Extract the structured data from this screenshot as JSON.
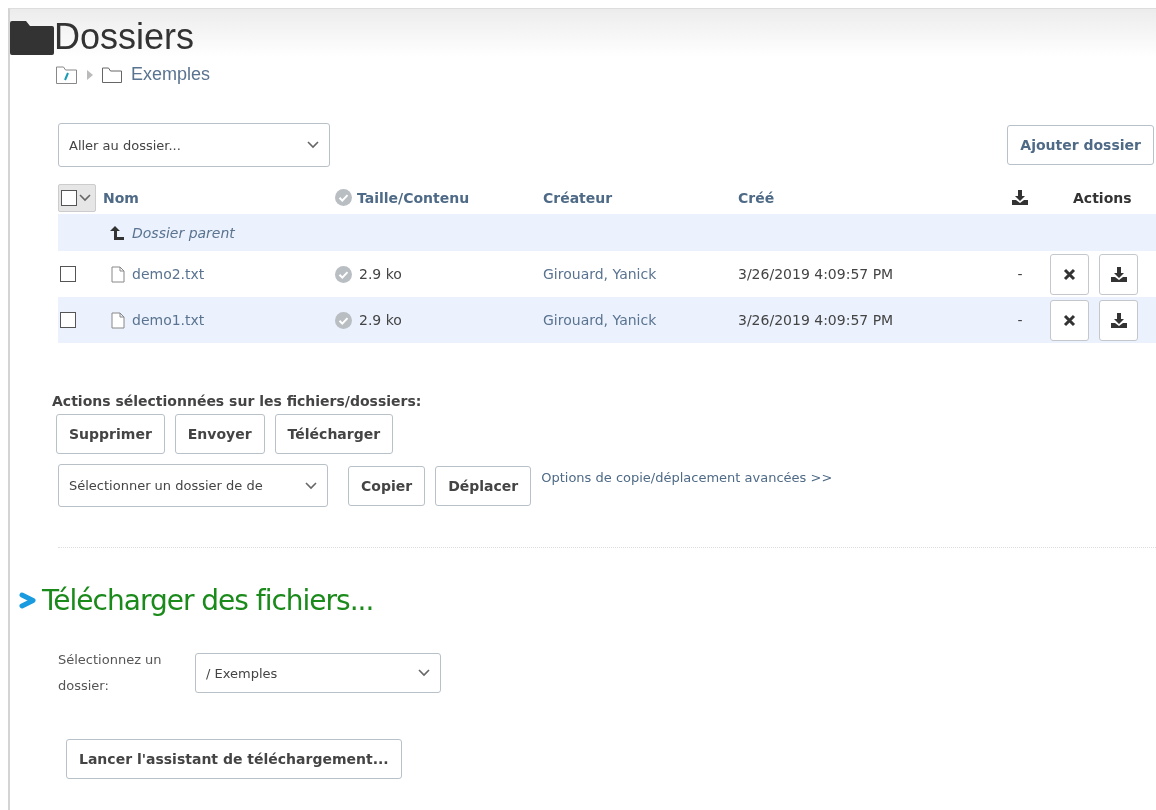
{
  "page": {
    "title": "Dossiers"
  },
  "breadcrumb": [
    {
      "label": "Exemples"
    }
  ],
  "goto_select": {
    "value": "Aller au dossier..."
  },
  "add_folder_button": "Ajouter dossier",
  "table": {
    "select_all": {
      "checked": false
    },
    "columns": [
      {
        "kind": "text",
        "label": "Nom"
      },
      {
        "kind": "status",
        "label": "Taille/Contenu"
      },
      {
        "kind": "text",
        "label": "Créateur"
      },
      {
        "kind": "text",
        "label": "Créé"
      },
      {
        "kind": "download"
      },
      {
        "kind": "plain",
        "label": "Actions"
      }
    ],
    "parent_row": "Dossier parent",
    "rows": [
      {
        "checked": false,
        "name": "demo2.txt",
        "size": "2.9 ko",
        "creator": "Girouard, Yanick",
        "created": "3/26/2019 4:09:57 PM",
        "downloads": "-"
      },
      {
        "checked": false,
        "name": "demo1.txt",
        "size": "2.9 ko",
        "creator": "Girouard, Yanick",
        "created": "3/26/2019 4:09:57 PM",
        "downloads": "-"
      }
    ]
  },
  "bulk": {
    "label": "Actions sélectionnées sur les fichiers/dossiers:",
    "buttons": [
      "Supprimer",
      "Envoyer",
      "Télécharger"
    ],
    "destination_select": "Sélectionner un dossier de de",
    "move_buttons": [
      "Copier",
      "Déplacer"
    ],
    "advanced_link": "Options de copie/déplacement avancées >>"
  },
  "upload": {
    "title": "Télécharger des fichiers...",
    "folder_label": "Sélectionnez un dossier:",
    "folder_select": "/ Exemples",
    "wizard_button": "Lancer l'assistant de téléchargement..."
  }
}
